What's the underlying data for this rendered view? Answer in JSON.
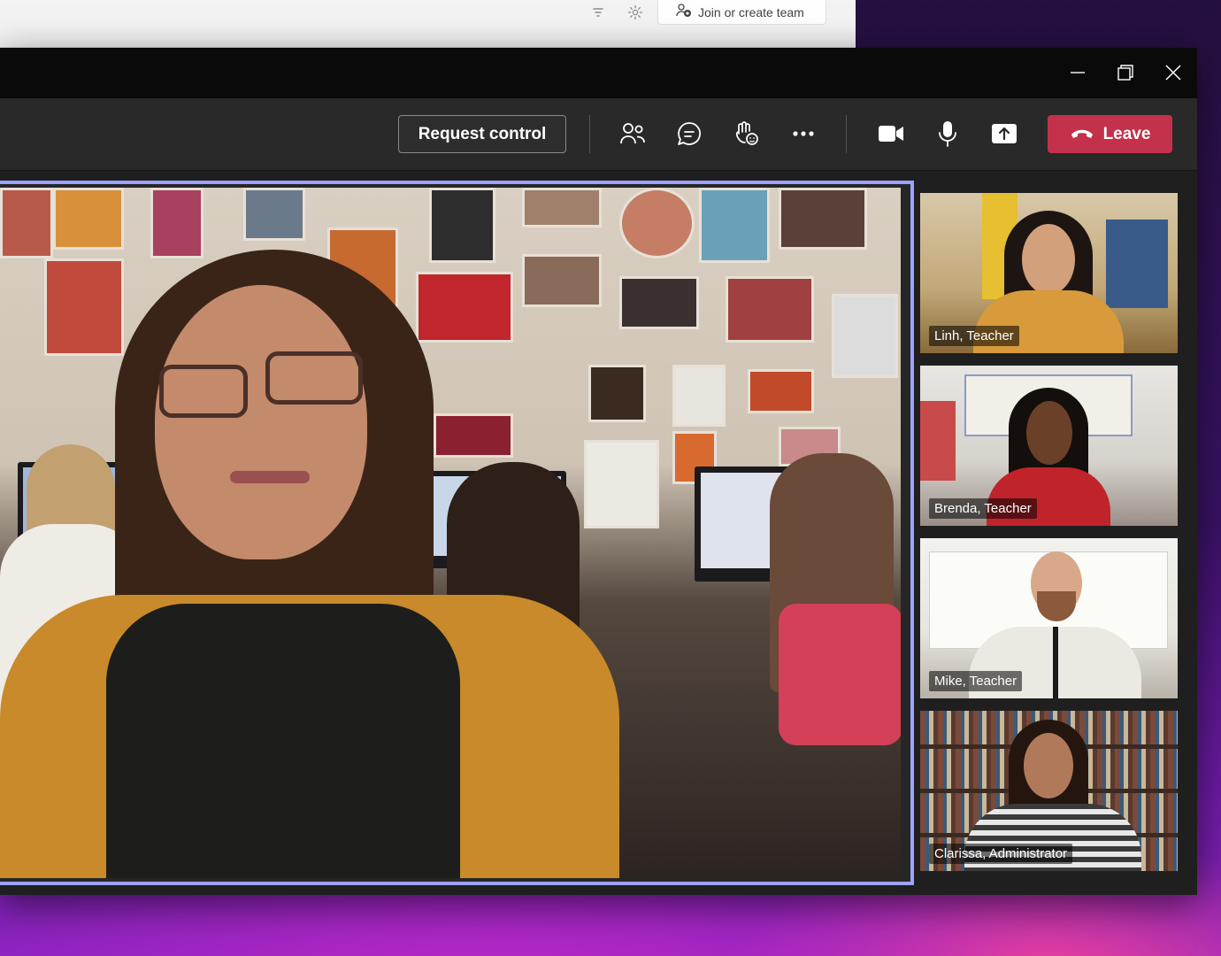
{
  "background_window": {
    "join_button_label": "Join or create team"
  },
  "toolbar": {
    "request_control_label": "Request control",
    "leave_label": "Leave"
  },
  "participants": [
    {
      "label": "Linh, Teacher"
    },
    {
      "label": "Brenda, Teacher"
    },
    {
      "label": "Mike, Teacher"
    },
    {
      "label": "Clarissa, Administrator"
    }
  ],
  "colors": {
    "active_speaker_border": "#9ea2ff",
    "leave_button": "#c4314b",
    "toolbar_bg": "#292929",
    "titlebar_bg": "#0a0a0a"
  },
  "icons": {
    "toolbar": [
      "people-icon",
      "chat-icon",
      "reactions-icon",
      "more-icon",
      "camera-icon",
      "mic-icon",
      "share-icon",
      "hang-up-icon"
    ],
    "window": [
      "minimize-icon",
      "restore-icon",
      "close-icon"
    ],
    "background_window": [
      "filter-icon",
      "settings-icon",
      "join-team-icon"
    ]
  }
}
